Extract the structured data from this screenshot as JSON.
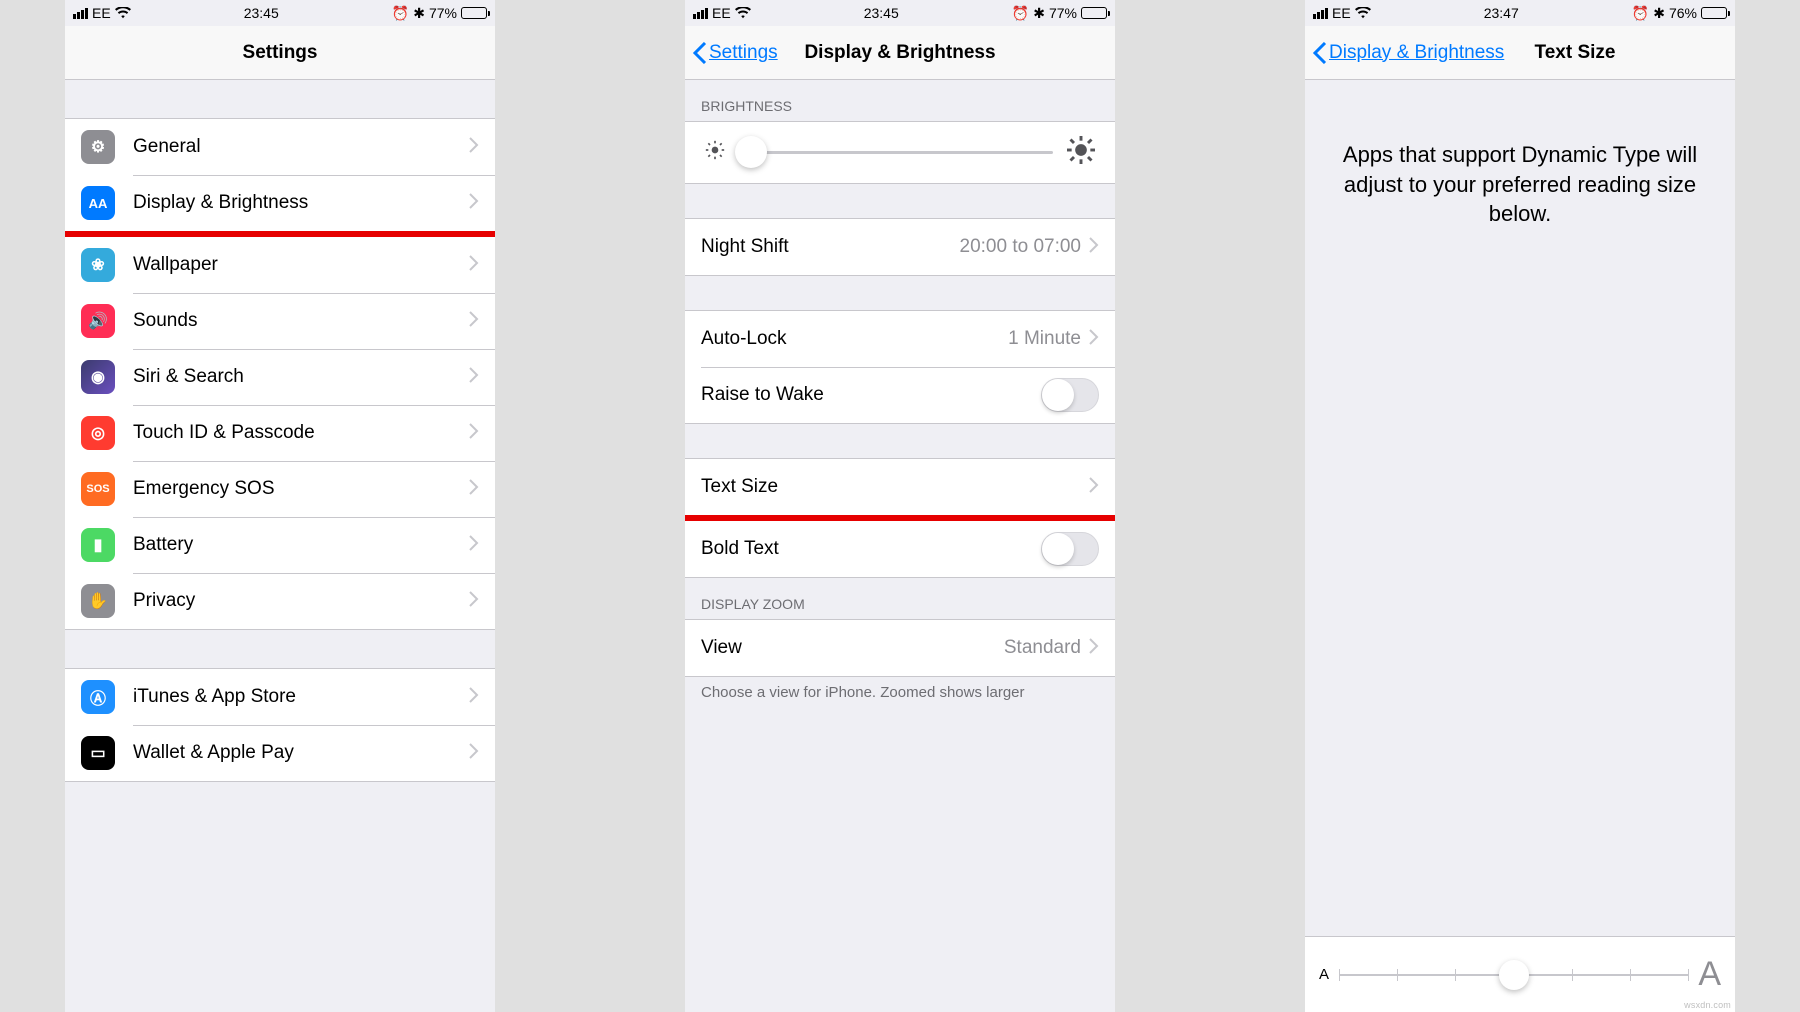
{
  "screens": {
    "settings": {
      "status": {
        "carrier": "EE",
        "time": "23:45",
        "battery_text": "77%"
      },
      "title": "Settings",
      "items": [
        {
          "icon": "gear",
          "label": "General"
        },
        {
          "icon": "textsize",
          "label": "Display & Brightness"
        },
        {
          "icon": "wallpaper",
          "label": "Wallpaper"
        },
        {
          "icon": "sounds",
          "label": "Sounds"
        },
        {
          "icon": "siri",
          "label": "Siri & Search"
        },
        {
          "icon": "touchid",
          "label": "Touch ID & Passcode"
        },
        {
          "icon": "sos",
          "label": "Emergency SOS"
        },
        {
          "icon": "battery",
          "label": "Battery"
        },
        {
          "icon": "privacy",
          "label": "Privacy"
        }
      ],
      "items2": [
        {
          "icon": "appstore",
          "label": "iTunes & App Store"
        },
        {
          "icon": "wallet",
          "label": "Wallet & Apple Pay"
        }
      ]
    },
    "display": {
      "status": {
        "carrier": "EE",
        "time": "23:45",
        "battery_text": "77%"
      },
      "back": "Settings",
      "title": "Display & Brightness",
      "brightness_header": "BRIGHTNESS",
      "night_shift": {
        "label": "Night Shift",
        "detail": "20:00 to 07:00"
      },
      "auto_lock": {
        "label": "Auto-Lock",
        "detail": "1 Minute"
      },
      "raise_wake": {
        "label": "Raise to Wake"
      },
      "text_size": {
        "label": "Text Size"
      },
      "bold_text": {
        "label": "Bold Text"
      },
      "zoom_header": "DISPLAY ZOOM",
      "view": {
        "label": "View",
        "detail": "Standard"
      },
      "zoom_footer": "Choose a view for iPhone. Zoomed shows larger"
    },
    "textsize": {
      "status": {
        "carrier": "EE",
        "time": "23:47",
        "battery_text": "76%"
      },
      "back": "Display & Brightness",
      "title": "Text Size",
      "description": "Apps that support Dynamic Type will adjust to your preferred reading size below.",
      "small_a": "A",
      "large_a": "A"
    }
  },
  "watermark": "wsxdn.com"
}
